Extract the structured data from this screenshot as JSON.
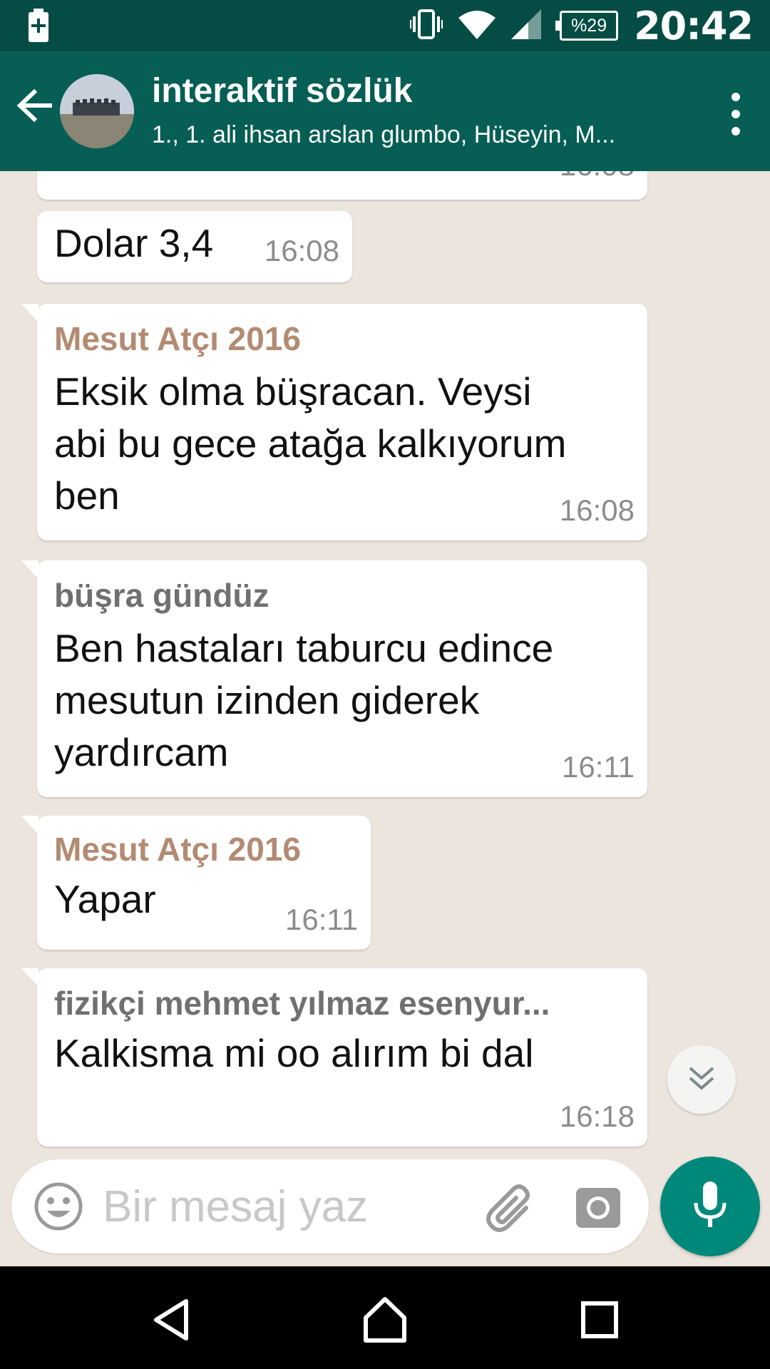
{
  "status_bar": {
    "battery_level": "%29",
    "time": "20:42",
    "icons": [
      "battery-charging-icon",
      "vibrate-icon",
      "wifi-icon",
      "signal-icon",
      "battery-icon"
    ]
  },
  "header": {
    "title": "interaktif sözlük",
    "subtitle": "1., 1. ali ihsan arslan glumbo, Hüseyin, M...",
    "icons": [
      "back-arrow-icon",
      "group-avatar",
      "more-vert-icon"
    ]
  },
  "messages": [
    {
      "sender": "",
      "text": [],
      "time": "16:08",
      "partial": true
    },
    {
      "sender": "",
      "text": [
        "Dolar 3,4"
      ],
      "time": "16:08"
    },
    {
      "sender": "Mesut Atçı 2016",
      "sender_color": "#b38b72",
      "text": [
        "Eksik olma büşracan. Veysi",
        "abi bu gece atağa kalkıyorum",
        "ben"
      ],
      "time": "16:08"
    },
    {
      "sender": "büşra gündüz",
      "sender_color": "#707070",
      "text": [
        "Ben hastaları taburcu edince",
        "mesutun izinden giderek",
        "yardırcam"
      ],
      "time": "16:11"
    },
    {
      "sender": "Mesut Atçı 2016",
      "sender_color": "#b38b72",
      "text": [
        "Yapar"
      ],
      "time": "16:11"
    },
    {
      "sender": "fizikçi mehmet yılmaz esenyur...",
      "sender_color": "#707070",
      "text": [
        "Kalkisma mi oo alırım bi dal"
      ],
      "time": "16:18"
    }
  ],
  "composer": {
    "placeholder": "Bir mesaj yaz",
    "icons": [
      "emoji-icon",
      "attach-icon",
      "camera-icon",
      "mic-icon",
      "scroll-down-icon"
    ]
  },
  "nav_bar": {
    "icons": [
      "nav-back-icon",
      "nav-home-icon",
      "nav-recents-icon"
    ]
  },
  "colors": {
    "status_bar": "#054d44",
    "toolbar": "#075e54",
    "chat_background": "#ece5dd",
    "accent": "#00897b"
  }
}
